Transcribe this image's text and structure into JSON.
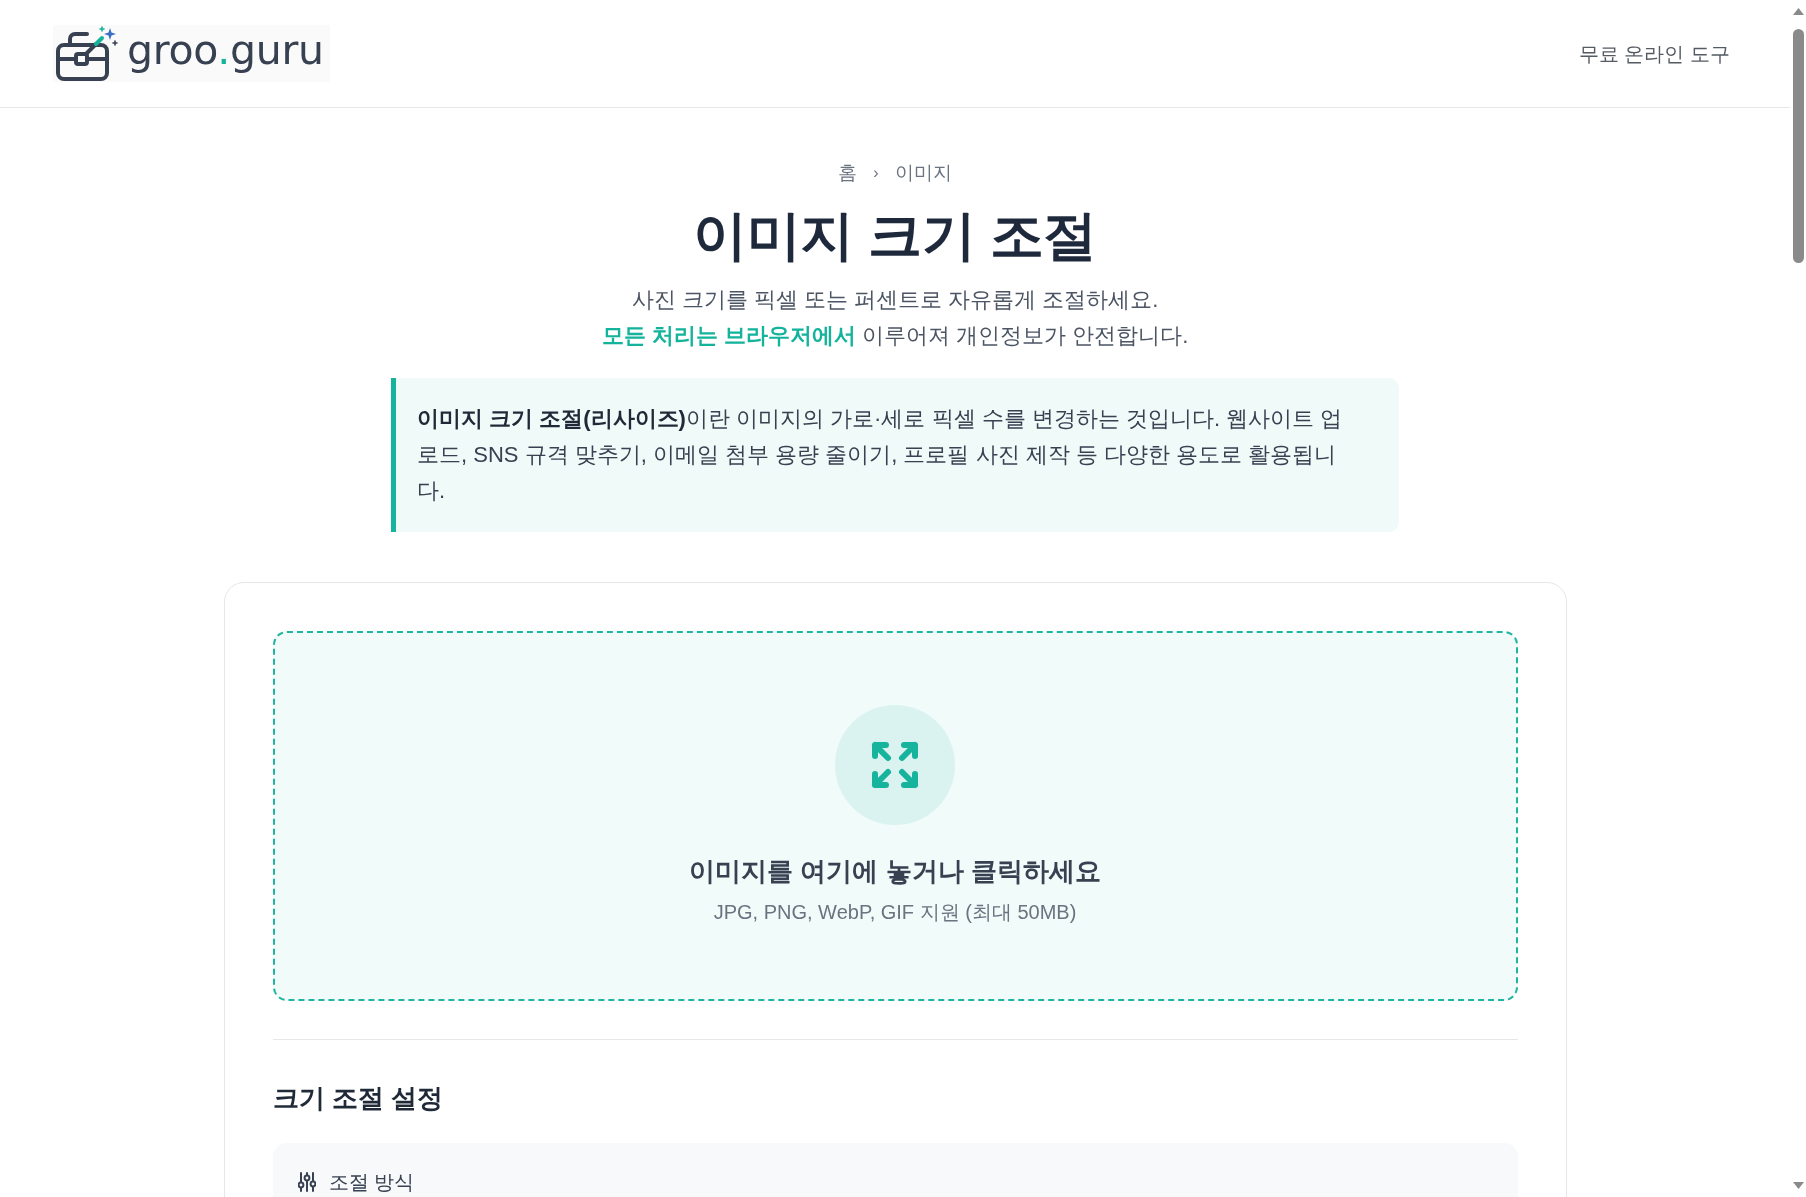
{
  "header": {
    "logo": {
      "parts": [
        {
          "text": "groo",
          "accent": false
        },
        {
          "text": ".",
          "accent": true
        },
        {
          "text": "guru",
          "accent": false
        }
      ]
    },
    "nav_link": "무료 온라인 도구"
  },
  "breadcrumb": {
    "items": [
      {
        "label": "홈"
      },
      {
        "label": "이미지"
      }
    ],
    "separator": "›"
  },
  "page": {
    "title": "이미지 크기 조절",
    "subtitle_lines": [
      "사진 크기를 픽셀 또는 퍼센트로 자유롭게 조절하세요.",
      "**모든 처리는 브라우저에서** 이루어져 개인정보가 안전합니다."
    ]
  },
  "info_box": {
    "text": "**이미지 크기 조절(리사이즈)**이란 이미지의 가로·세로 픽셀 수를 변경하는 것입니다. 웹사이트 업로드, SNS 규격 맞추기, 이메일 첨부 용량 줄이기, 프로필 사진 제작 등 다양한 용도로 활용됩니다."
  },
  "upload": {
    "title": "이미지를 여기에 놓거나 클릭하세요",
    "hint": "JPG, PNG, WebP, GIF 지원 (최대 50MB)"
  },
  "settings": {
    "heading": "크기 조절 설정",
    "sections": [
      {
        "label": "조절 방식"
      }
    ]
  }
}
